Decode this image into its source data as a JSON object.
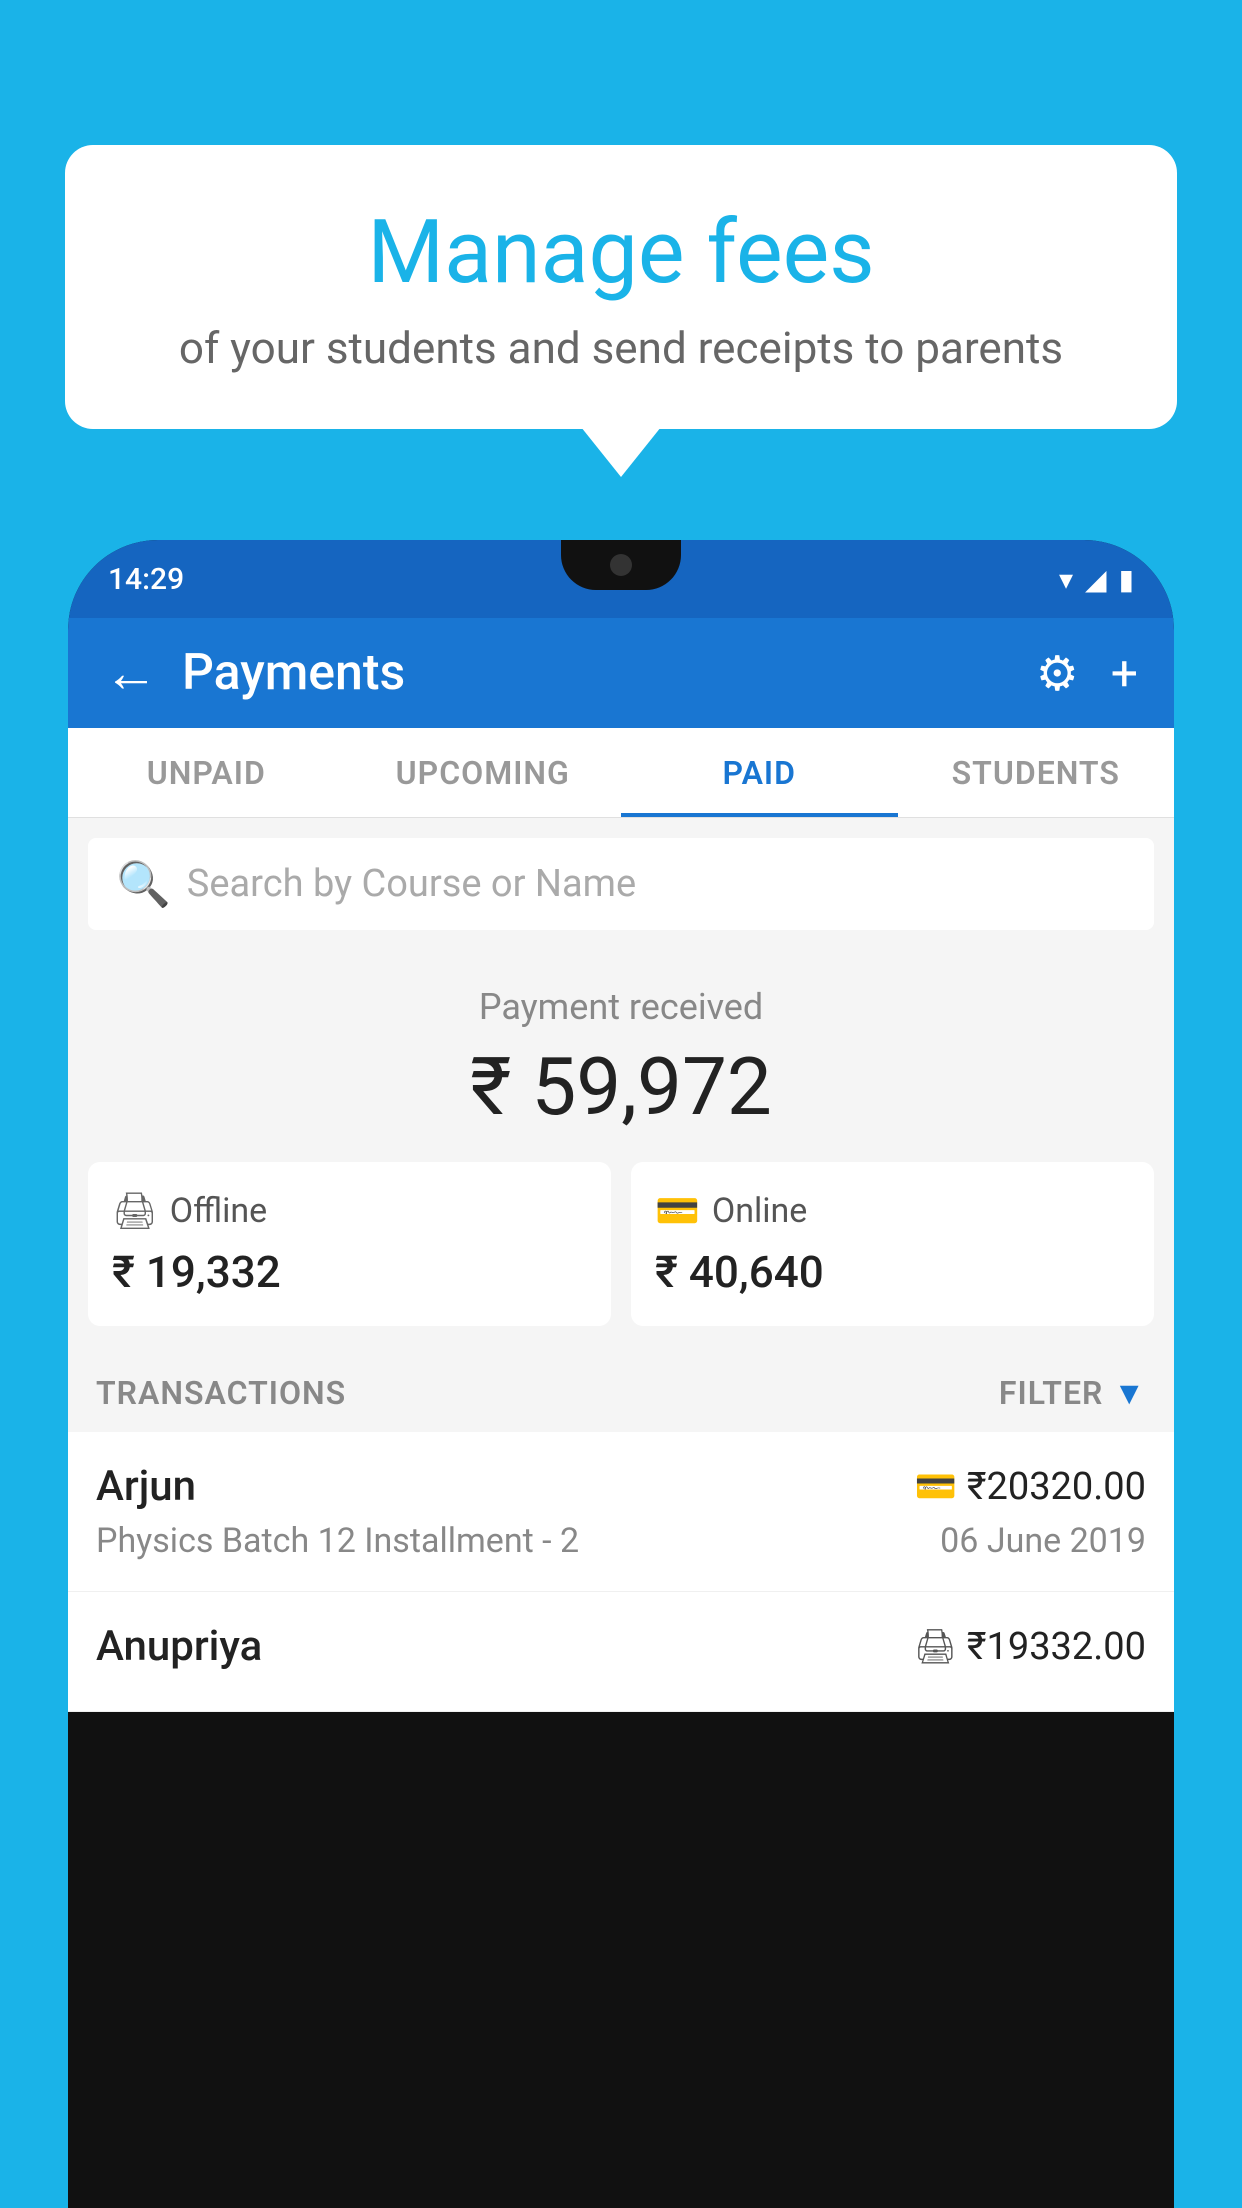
{
  "background_color": "#1ab3e8",
  "speech_bubble": {
    "title": "Manage fees",
    "subtitle": "of your students and send receipts to parents"
  },
  "status_bar": {
    "time": "14:29",
    "wifi": "▾",
    "signal": "▲",
    "battery": "▮"
  },
  "app_bar": {
    "title": "Payments",
    "back_icon": "←",
    "settings_icon": "⚙",
    "add_icon": "+"
  },
  "tabs": [
    {
      "label": "UNPAID",
      "active": false
    },
    {
      "label": "UPCOMING",
      "active": false
    },
    {
      "label": "PAID",
      "active": true
    },
    {
      "label": "STUDENTS",
      "active": false
    }
  ],
  "search": {
    "placeholder": "Search by Course or Name"
  },
  "payment_summary": {
    "label": "Payment received",
    "total": "₹ 59,972",
    "offline": {
      "label": "Offline",
      "amount": "₹ 19,332"
    },
    "online": {
      "label": "Online",
      "amount": "₹ 40,640"
    }
  },
  "transactions": {
    "header": "TRANSACTIONS",
    "filter": "FILTER",
    "rows": [
      {
        "name": "Arjun",
        "course": "Physics Batch 12 Installment - 2",
        "amount": "₹20320.00",
        "date": "06 June 2019",
        "payment_type": "card"
      },
      {
        "name": "Anupriya",
        "course": "",
        "amount": "₹19332.00",
        "date": "",
        "payment_type": "cash"
      }
    ]
  }
}
